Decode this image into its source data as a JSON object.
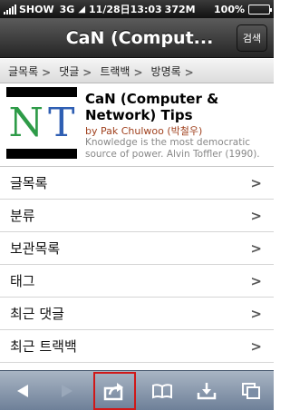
{
  "status": {
    "carrier": "SHOW",
    "network": "3G",
    "datetime": "11/28日13:03",
    "memory": "372M",
    "battery": "100%",
    "battery_level": 1.0
  },
  "navbar": {
    "title": "CaN (Comput...",
    "search_label": "검색"
  },
  "breadcrumb": [
    "글목록",
    "댓글",
    "트랙백",
    "방명록"
  ],
  "blog": {
    "logo_letters": [
      "N",
      "T"
    ],
    "title": "CaN (Computer & Network) Tips",
    "author": "by Pak Chulwoo (박철우)",
    "description": "Knowledge is the most democratic source of power. Alvin Toffler (1990)."
  },
  "menu": [
    {
      "label": "글목록"
    },
    {
      "label": "분류"
    },
    {
      "label": "보관목록"
    },
    {
      "label": "태그"
    },
    {
      "label": "최근 댓글"
    },
    {
      "label": "최근 트랙백"
    }
  ],
  "toolbar": {
    "items": [
      "back-icon",
      "forward-icon",
      "share-icon",
      "bookmarks-icon",
      "download-icon",
      "pages-icon"
    ]
  },
  "colors": {
    "highlight": "#d01818",
    "author": "#a0411e",
    "logo_n": "#2e9b48",
    "logo_t": "#2f5fb3"
  }
}
